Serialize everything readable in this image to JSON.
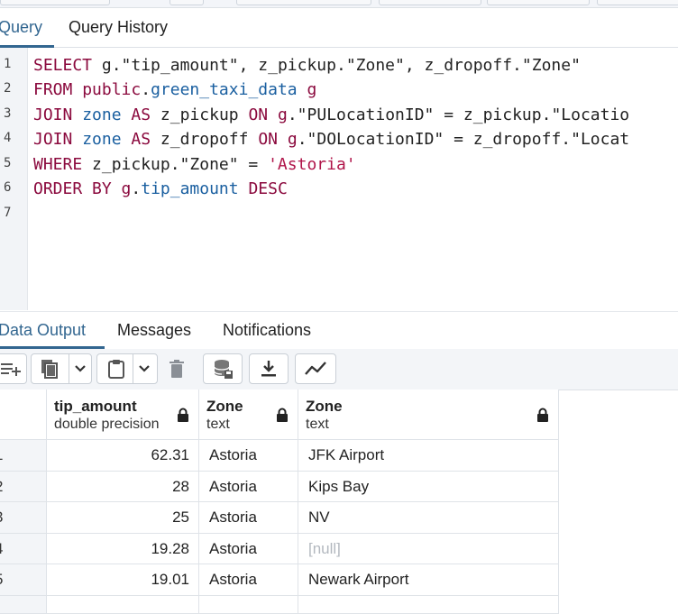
{
  "query_tabs": [
    {
      "label": "Query",
      "active": true
    },
    {
      "label": "Query History",
      "active": false
    }
  ],
  "editor": {
    "line_numbers": [
      "1",
      "2",
      "3",
      "4",
      "5",
      "6",
      "7"
    ],
    "lines": [
      [
        {
          "t": "kw",
          "v": "SELECT"
        },
        {
          "t": "p",
          "v": " g."
        },
        {
          "t": "p",
          "v": "\"tip_amount\""
        },
        {
          "t": "p",
          "v": ", z_pickup."
        },
        {
          "t": "p",
          "v": "\"Zone\""
        },
        {
          "t": "p",
          "v": ", z_dropoff."
        },
        {
          "t": "p",
          "v": "\"Zone\""
        }
      ],
      [
        {
          "t": "kw",
          "v": "FROM"
        },
        {
          "t": "p",
          "v": " "
        },
        {
          "t": "kw",
          "v": "public"
        },
        {
          "t": "p",
          "v": "."
        },
        {
          "t": "id",
          "v": "green_taxi_data"
        },
        {
          "t": "p",
          "v": " "
        },
        {
          "t": "kw",
          "v": "g"
        }
      ],
      [
        {
          "t": "kw",
          "v": "JOIN"
        },
        {
          "t": "p",
          "v": " "
        },
        {
          "t": "id",
          "v": "zone"
        },
        {
          "t": "p",
          "v": " "
        },
        {
          "t": "kw",
          "v": "AS"
        },
        {
          "t": "p",
          "v": " z_pickup "
        },
        {
          "t": "kw",
          "v": "ON"
        },
        {
          "t": "p",
          "v": " "
        },
        {
          "t": "kw",
          "v": "g"
        },
        {
          "t": "p",
          "v": ".\"PULocationID\" = z_pickup.\"Locatio"
        }
      ],
      [
        {
          "t": "kw",
          "v": "JOIN"
        },
        {
          "t": "p",
          "v": " "
        },
        {
          "t": "id",
          "v": "zone"
        },
        {
          "t": "p",
          "v": " "
        },
        {
          "t": "kw",
          "v": "AS"
        },
        {
          "t": "p",
          "v": " z_dropoff "
        },
        {
          "t": "kw",
          "v": "ON"
        },
        {
          "t": "p",
          "v": " "
        },
        {
          "t": "kw",
          "v": "g"
        },
        {
          "t": "p",
          "v": ".\"DOLocationID\" = z_dropoff.\"Locat"
        }
      ],
      [
        {
          "t": "kw",
          "v": "WHERE"
        },
        {
          "t": "p",
          "v": " z_pickup.\"Zone\" = "
        },
        {
          "t": "str",
          "v": "'Astoria'"
        }
      ],
      [
        {
          "t": "kw",
          "v": "ORDER BY"
        },
        {
          "t": "p",
          "v": " "
        },
        {
          "t": "kw",
          "v": "g"
        },
        {
          "t": "p",
          "v": "."
        },
        {
          "t": "id",
          "v": "tip_amount"
        },
        {
          "t": "p",
          "v": " "
        },
        {
          "t": "kw",
          "v": "DESC"
        }
      ],
      []
    ]
  },
  "output_tabs": [
    {
      "label": "Data Output",
      "active": true
    },
    {
      "label": "Messages",
      "active": false
    },
    {
      "label": "Notifications",
      "active": false
    }
  ],
  "toolbar_icons": [
    "add-row-icon",
    "copy-icon",
    "dropdown-icon",
    "paste-icon",
    "dropdown-icon",
    "delete-icon",
    "save-data-icon",
    "download-icon",
    "graph-visualiser-icon"
  ],
  "columns": [
    {
      "name": "tip_amount",
      "type": "double precision"
    },
    {
      "name": "Zone",
      "type": "text"
    },
    {
      "name": "Zone",
      "type": "text"
    }
  ],
  "rows": [
    {
      "n": "1",
      "tip": "62.31",
      "pickup": "Astoria",
      "dropoff": "JFK Airport",
      "null": false
    },
    {
      "n": "2",
      "tip": "28",
      "pickup": "Astoria",
      "dropoff": "Kips Bay",
      "null": false
    },
    {
      "n": "3",
      "tip": "25",
      "pickup": "Astoria",
      "dropoff": "NV",
      "null": false
    },
    {
      "n": "4",
      "tip": "19.28",
      "pickup": "Astoria",
      "dropoff": "[null]",
      "null": true
    },
    {
      "n": "5",
      "tip": "19.01",
      "pickup": "Astoria",
      "dropoff": "Newark Airport",
      "null": false
    }
  ],
  "colors": {
    "accent": "#326690",
    "keyword": "#8b0a3e",
    "identifier": "#1a5fa0",
    "string": "#b0154a"
  }
}
